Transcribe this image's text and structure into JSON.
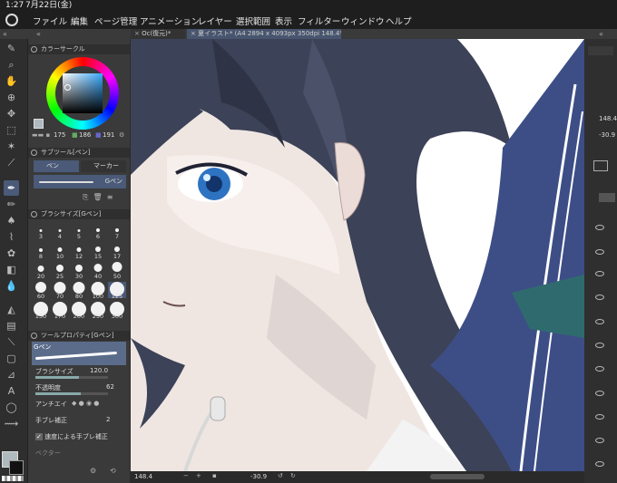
{
  "status_bar": {
    "time": "1:27",
    "date": "7月22日(金)"
  },
  "menu": [
    "ファイル",
    "編集",
    "ページ管理",
    "アニメーション",
    "レイヤー",
    "選択範囲",
    "表示",
    "フィルター",
    "ウィンドウ",
    "ヘルプ"
  ],
  "tabs": [
    {
      "label": "Oc(復元)*"
    },
    {
      "label": "夏イラスト* (A4 2894 x 4093px 350dpi 148.4%)"
    }
  ],
  "color_circle": {
    "title": "カラーサークル",
    "values": [
      "175",
      "186",
      "191"
    ],
    "selected_color": "#afbabf"
  },
  "sub_tool": {
    "title": "サブツール[ペン]",
    "tabs": [
      "ペン",
      "マーカー"
    ],
    "selected": "Gペン"
  },
  "brush_size": {
    "title": "ブラシサイズ[Gペン]",
    "sizes": [
      "3",
      "4",
      "5",
      "6",
      "7",
      "8",
      "10",
      "12",
      "15",
      "17",
      "20",
      "25",
      "30",
      "40",
      "50",
      "60",
      "70",
      "80",
      "100",
      "125",
      "150",
      "170",
      "200",
      "250",
      "300"
    ],
    "selected": "125"
  },
  "tool_property": {
    "title": "ツールプロパティ[Gペン]",
    "preview_label": "Gペン",
    "brush_size_label": "ブラシサイズ",
    "brush_size_value": "120.0",
    "opacity_label": "不透明度",
    "opacity_value": "62",
    "antialias_label": "アンチエイ",
    "stabilization_label": "手ブレ補正",
    "stabilization_value": "2",
    "speed_label": "速度による手ブレ補正",
    "vector_label": "ベクター"
  },
  "right_panel": {
    "value1": "148.4",
    "value2": "-30.9"
  },
  "bottom_bar": {
    "zoom": "148.4",
    "angle": "-30.9"
  },
  "colors": {
    "accent": "#4a5a78",
    "canvas": "#ffffff",
    "hair": "#3c4257",
    "eye": "#2d73c2"
  }
}
